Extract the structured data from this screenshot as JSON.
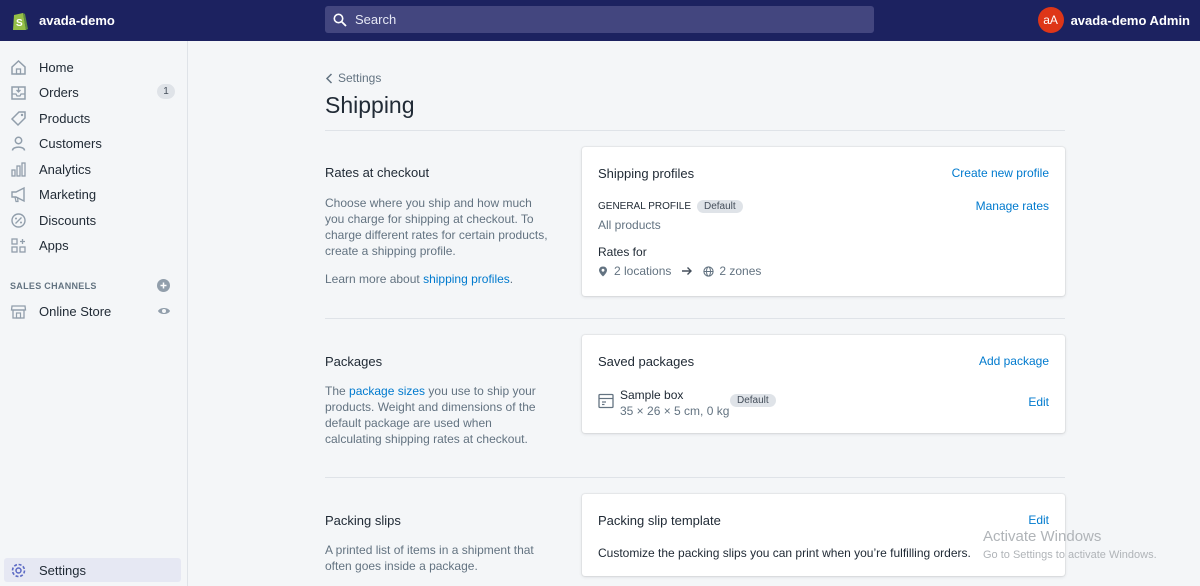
{
  "topbar": {
    "store_name": "avada-demo",
    "search_placeholder": "Search",
    "avatar_initials": "aA",
    "user_name": "avada-demo Admin"
  },
  "sidebar": {
    "items": [
      {
        "label": "Home",
        "icon": "home-icon"
      },
      {
        "label": "Orders",
        "icon": "orders-icon",
        "badge": "1"
      },
      {
        "label": "Products",
        "icon": "tag-icon"
      },
      {
        "label": "Customers",
        "icon": "person-icon"
      },
      {
        "label": "Analytics",
        "icon": "chart-icon"
      },
      {
        "label": "Marketing",
        "icon": "megaphone-icon"
      },
      {
        "label": "Discounts",
        "icon": "discount-icon"
      },
      {
        "label": "Apps",
        "icon": "apps-icon"
      }
    ],
    "channels_label": "SALES CHANNELS",
    "online_store": "Online Store",
    "settings": "Settings"
  },
  "page": {
    "breadcrumb": "Settings",
    "title": "Shipping"
  },
  "rates": {
    "title": "Rates at checkout",
    "desc": "Choose where you ship and how much you charge for shipping at checkout. To charge different rates for certain products, create a shipping profile.",
    "learn_prefix": "Learn more about ",
    "learn_link": "shipping profiles",
    "learn_suffix": "."
  },
  "profiles_card": {
    "title": "Shipping profiles",
    "action": "Create new profile",
    "profile_name": "GENERAL PROFILE",
    "profile_badge": "Default",
    "profile_scope": "All products",
    "manage": "Manage rates",
    "rates_for": "Rates for",
    "locations": "2 locations",
    "zones": "2 zones"
  },
  "packages": {
    "title": "Packages",
    "desc_prefix": "The ",
    "desc_link": "package sizes",
    "desc_suffix": " you use to ship your products. Weight and dimensions of the default package are used when calculating shipping rates at checkout."
  },
  "packages_card": {
    "title": "Saved packages",
    "action": "Add package",
    "package_name": "Sample box",
    "package_dims": "35 × 26 × 5 cm, 0 kg",
    "package_badge": "Default",
    "edit": "Edit"
  },
  "slips": {
    "title": "Packing slips",
    "desc": "A printed list of items in a shipment that often goes inside a package."
  },
  "slips_card": {
    "title": "Packing slip template",
    "action": "Edit",
    "desc": "Customize the packing slips you can print when you’re fulfilling orders."
  },
  "watermark": {
    "line1": "Activate Windows",
    "line2": "Go to Settings to activate Windows."
  },
  "colors": {
    "topbar": "#1c2260",
    "link": "#007ace",
    "avatar": "#de3618"
  }
}
